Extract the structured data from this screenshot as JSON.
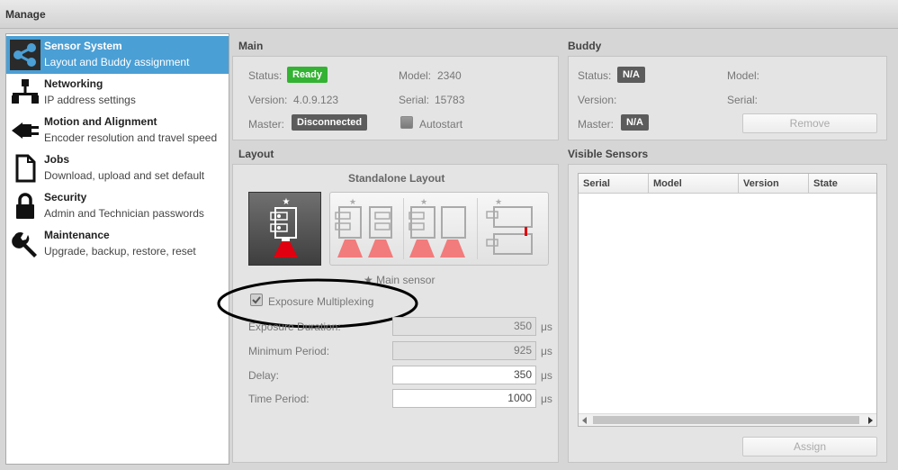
{
  "window": {
    "title": "Manage"
  },
  "sidebar": {
    "items": [
      {
        "title": "Sensor System",
        "subtitle": "Layout and Buddy assignment"
      },
      {
        "title": "Networking",
        "subtitle": "IP address settings"
      },
      {
        "title": "Motion and Alignment",
        "subtitle": "Encoder resolution and travel speed"
      },
      {
        "title": "Jobs",
        "subtitle": "Download, upload and set default"
      },
      {
        "title": "Security",
        "subtitle": "Admin and Technician passwords"
      },
      {
        "title": "Maintenance",
        "subtitle": "Upgrade, backup, restore, reset"
      }
    ]
  },
  "main": {
    "heading": "Main",
    "status_label": "Status:",
    "status_value": "Ready",
    "model_label": "Model:",
    "model_value": "2340",
    "version_label": "Version:",
    "version_value": "4.0.9.123",
    "serial_label": "Serial:",
    "serial_value": "15783",
    "master_label": "Master:",
    "master_value": "Disconnected",
    "autostart_label": "Autostart"
  },
  "buddy": {
    "heading": "Buddy",
    "status_label": "Status:",
    "status_value": "N/A",
    "model_label": "Model:",
    "version_label": "Version:",
    "serial_label": "Serial:",
    "master_label": "Master:",
    "master_value": "N/A",
    "remove_label": "Remove"
  },
  "layout": {
    "heading": "Layout",
    "layout_title": "Standalone Layout",
    "main_sensor_note": "Main sensor",
    "exposure_multiplexing_label": "Exposure Multiplexing",
    "exposure_multiplexing_checked": true,
    "rows": [
      {
        "label": "Exposure Duration:",
        "value": "350",
        "unit": "μs",
        "enabled": false
      },
      {
        "label": "Minimum Period:",
        "value": "925",
        "unit": "μs",
        "enabled": false
      },
      {
        "label": "Delay:",
        "value": "350",
        "unit": "μs",
        "enabled": true
      },
      {
        "label": "Time Period:",
        "value": "1000",
        "unit": "μs",
        "enabled": true
      }
    ]
  },
  "visible_sensors": {
    "heading": "Visible Sensors",
    "columns": [
      "Serial",
      "Model",
      "Version",
      "State"
    ],
    "assign_label": "Assign"
  },
  "colors": {
    "accent": "#4a9fd5",
    "ready_green": "#34b233",
    "badge_dark": "#5c5c5c",
    "laser_red": "#e0000f",
    "laser_pink": "#f27b7b"
  }
}
